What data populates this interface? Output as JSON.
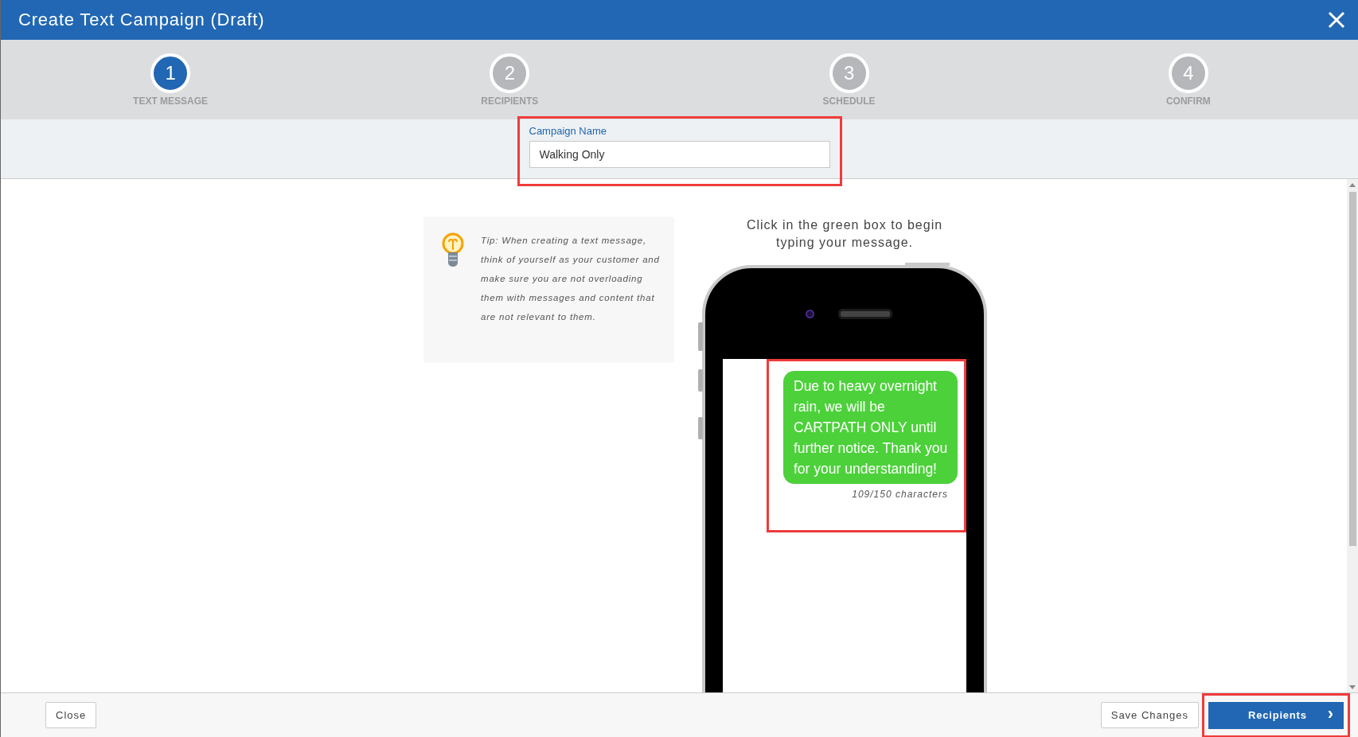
{
  "window": {
    "title": "Create Text Campaign (Draft)"
  },
  "steps": [
    {
      "number": "1",
      "label": "TEXT MESSAGE",
      "selected": true
    },
    {
      "number": "2",
      "label": "RECIPIENTS",
      "selected": false
    },
    {
      "number": "3",
      "label": "SCHEDULE",
      "selected": false
    },
    {
      "number": "4",
      "label": "CONFIRM",
      "selected": false
    }
  ],
  "campaign_name": {
    "label": "Campaign Name",
    "value": "Walking Only",
    "highlighted": true
  },
  "tip": {
    "text": "Tip: When creating a text message, think of yourself as your customer and make sure you are not overloading them with messages and content that are not relevant to them."
  },
  "instruction": "Click in the green box to begin typing your message.",
  "message": {
    "text": "Due to heavy overnight rain, we will be CARTPATH ONLY until further notice. Thank you for your understanding!",
    "counter": "109/150 characters",
    "highlighted": true
  },
  "footer": {
    "close": "Close",
    "save": "Save Changes",
    "next": {
      "label": "Recipients",
      "icon": "›",
      "highlighted": true
    }
  }
}
